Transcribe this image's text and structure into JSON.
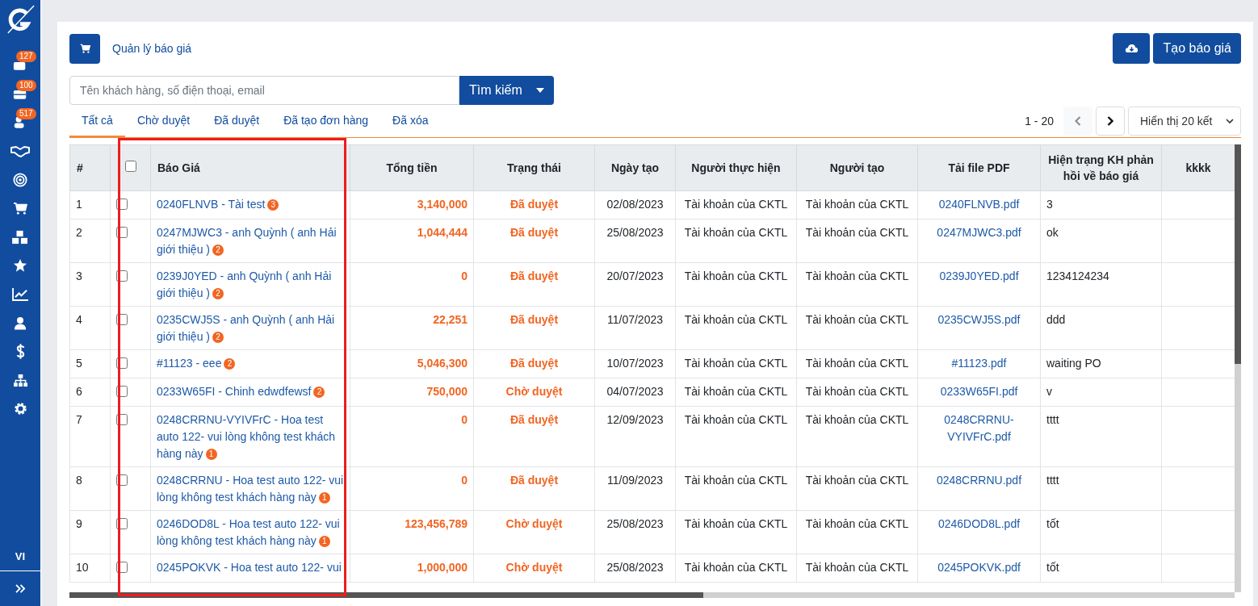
{
  "sidebar": {
    "badges": [
      "127",
      "100",
      "517"
    ],
    "language": "VI"
  },
  "header": {
    "title": "Quản lý báo giá",
    "create_button": "Tạo báo giá"
  },
  "search": {
    "placeholder": "Tên khách hàng, số điện thoại, email",
    "button": "Tìm kiếm"
  },
  "tabs": [
    {
      "label": "Tất cả",
      "selected": true
    },
    {
      "label": "Chờ duyệt",
      "selected": false
    },
    {
      "label": "Đã duyệt",
      "selected": false
    },
    {
      "label": "Đã tạo đơn hàng",
      "selected": false
    },
    {
      "label": "Đã xóa",
      "selected": false
    }
  ],
  "pagination": {
    "range": "1 - 20",
    "prev_disabled": true,
    "page_size": "Hiển thị 20 kết"
  },
  "table": {
    "header_checked": false,
    "columns": [
      "#",
      "Báo Giá",
      "Tổng tiền",
      "Trạng thái",
      "Ngày tạo",
      "Người thực hiện",
      "Người tạo",
      "Tải file PDF",
      "Hiện trạng KH phản hồi về báo giá",
      "kkkk"
    ],
    "rows": [
      {
        "no": "1",
        "checked": false,
        "quote": {
          "text": "0240FLNVB - Tài test",
          "badge": "3"
        },
        "total": "3,140,000",
        "status": "Đã duyệt",
        "date": "02/08/2023",
        "assignee": "Tài khoản của CKTL",
        "creator": "Tài khoản của CKTL",
        "pdf": "0240FLNVB.pdf",
        "feedback": "3"
      },
      {
        "no": "2",
        "checked": false,
        "quote": {
          "text": "0247MJWC3 - anh Quỳnh ( anh Hải giới thiệu )",
          "badge": "2"
        },
        "total": "1,044,444",
        "status": "Đã duyệt",
        "date": "25/08/2023",
        "assignee": "Tài khoản của CKTL",
        "creator": "Tài khoản của CKTL",
        "pdf": "0247MJWC3.pdf",
        "feedback": "ok"
      },
      {
        "no": "3",
        "checked": false,
        "quote": {
          "text": "0239J0YED - anh Quỳnh ( anh Hải giới thiệu )",
          "badge": "2"
        },
        "total": "0",
        "status": "Đã duyệt",
        "date": "20/07/2023",
        "assignee": "Tài khoản của CKTL",
        "creator": "Tài khoản của CKTL",
        "pdf": "0239J0YED.pdf",
        "feedback": "1234124234"
      },
      {
        "no": "4",
        "checked": false,
        "quote": {
          "text": "0235CWJ5S - anh Quỳnh ( anh Hải giới thiệu )",
          "badge": "2"
        },
        "total": "22,251",
        "status": "Đã duyệt",
        "date": "11/07/2023",
        "assignee": "Tài khoản của CKTL",
        "creator": "Tài khoản của CKTL",
        "pdf": "0235CWJ5S.pdf",
        "feedback": "ddd"
      },
      {
        "no": "5",
        "checked": false,
        "quote": {
          "text": "#11123 - eee",
          "badge": "2"
        },
        "total": "5,046,300",
        "status": "Đã duyệt",
        "date": "10/07/2023",
        "assignee": "Tài khoản của CKTL",
        "creator": "Tài khoản của CKTL",
        "pdf": "#11123.pdf",
        "feedback": "waiting PO"
      },
      {
        "no": "6",
        "checked": false,
        "quote": {
          "text": "0233W65FI - Chinh edwdfewsf",
          "badge": "2"
        },
        "total": "750,000",
        "status": "Chờ duyệt",
        "date": "04/07/2023",
        "assignee": "Tài khoản của CKTL",
        "creator": "Tài khoản của CKTL",
        "pdf": "0233W65FI.pdf",
        "feedback": "v"
      },
      {
        "no": "7",
        "checked": false,
        "quote": {
          "text": "0248CRRNU-VYIVFrC - Hoa test auto 122- vui lòng không test khách hàng này",
          "badge": "1"
        },
        "total": "0",
        "status": "Đã duyệt",
        "date": "12/09/2023",
        "assignee": "Tài khoản của CKTL",
        "creator": "Tài khoản của CKTL",
        "pdf": "0248CRRNU-VYIVFrC.pdf",
        "feedback": "tttt"
      },
      {
        "no": "8",
        "checked": false,
        "quote": {
          "text": "0248CRRNU - Hoa test auto 122- vui lòng không test khách hàng này",
          "badge": "1"
        },
        "total": "0",
        "status": "Đã duyệt",
        "date": "11/09/2023",
        "assignee": "Tài khoản của CKTL",
        "creator": "Tài khoản của CKTL",
        "pdf": "0248CRRNU.pdf",
        "feedback": "tttt"
      },
      {
        "no": "9",
        "checked": false,
        "quote": {
          "text": "0246DOD8L - Hoa test auto 122- vui lòng không test khách hàng này",
          "badge": "1"
        },
        "total": "123,456,789",
        "status": "Chờ duyệt",
        "date": "25/08/2023",
        "assignee": "Tài khoản của CKTL",
        "creator": "Tài khoản của CKTL",
        "pdf": "0246DOD8L.pdf",
        "feedback": "tốt"
      },
      {
        "no": "10",
        "checked": false,
        "quote": {
          "text": "0245POKVK - Hoa test auto 122- vui"
        },
        "total": "1,000,000",
        "status": "Chờ duyệt",
        "date": "25/08/2023",
        "assignee": "Tài khoản của CKTL",
        "creator": "Tài khoản của CKTL",
        "pdf": "0245POKVK.pdf",
        "feedback": "tốt"
      }
    ]
  }
}
